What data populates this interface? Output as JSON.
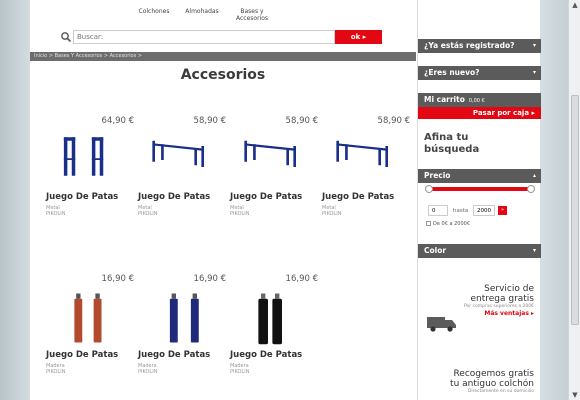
{
  "nav": {
    "items": [
      "Colchones",
      "Almohadas",
      "Bases y",
      "Accesorios"
    ]
  },
  "search": {
    "placeholder": "Buscar:",
    "ok_label": "ok"
  },
  "breadcrumb": "Inicio > Bases Y Accesorios > Accesorios >",
  "page_title": "Accesorios",
  "products": [
    {
      "price": "64,90 €",
      "name": "Juego De Patas",
      "material": "Metal",
      "brand": "PIKOLIN",
      "kind": "legs-blue"
    },
    {
      "price": "58,90 €",
      "name": "Juego De Patas",
      "material": "Metal",
      "brand": "PIKOLIN",
      "kind": "frame-blue"
    },
    {
      "price": "58,90 €",
      "name": "Juego De Patas",
      "material": "Metal",
      "brand": "PIKOLIN",
      "kind": "frame-blue"
    },
    {
      "price": "58,90 €",
      "name": "Juego De Patas",
      "material": "Metal",
      "brand": "PIKOLIN",
      "kind": "frame-blue"
    },
    {
      "price": "16,90 €",
      "name": "Juego De Patas",
      "material": "Madera",
      "brand": "PIKOLIN",
      "kind": "leg-brown"
    },
    {
      "price": "16,90 €",
      "name": "Juego De Patas",
      "material": "Madera",
      "brand": "PIKOLIN",
      "kind": "leg-navy"
    },
    {
      "price": "16,90 €",
      "name": "Juego De Patas",
      "material": "Madera",
      "brand": "PIKOLIN",
      "kind": "leg-black"
    }
  ],
  "sidebar": {
    "registered": "¿Ya estás registrado?",
    "new_user": "¿Eres nuevo?",
    "cart_label": "Mi carrito",
    "cart_total": "0,00 €",
    "pay_label": "Pasar por caja",
    "refine_title_1": "Afina tu",
    "refine_title_2": "búsqueda",
    "price_label": "Precio",
    "price_min": "0",
    "price_to": "hasta",
    "price_max": "2000",
    "price_check": "De 0€ a 2000€",
    "color_label": "Color",
    "promo1_title_1": "Servicio de",
    "promo1_title_2": "entrega gratis",
    "promo1_sub": "Por compras superiores a 200€",
    "promo1_link": "Más ventajas",
    "promo2_title_1": "Recogemos gratis",
    "promo2_title_2": "tu antiguo colchón",
    "promo2_sub": "Directamente en su domicilio"
  },
  "colors": {
    "accent": "#e30613",
    "bar": "#5b5b5b",
    "product_blue": "#1a2f8a"
  }
}
